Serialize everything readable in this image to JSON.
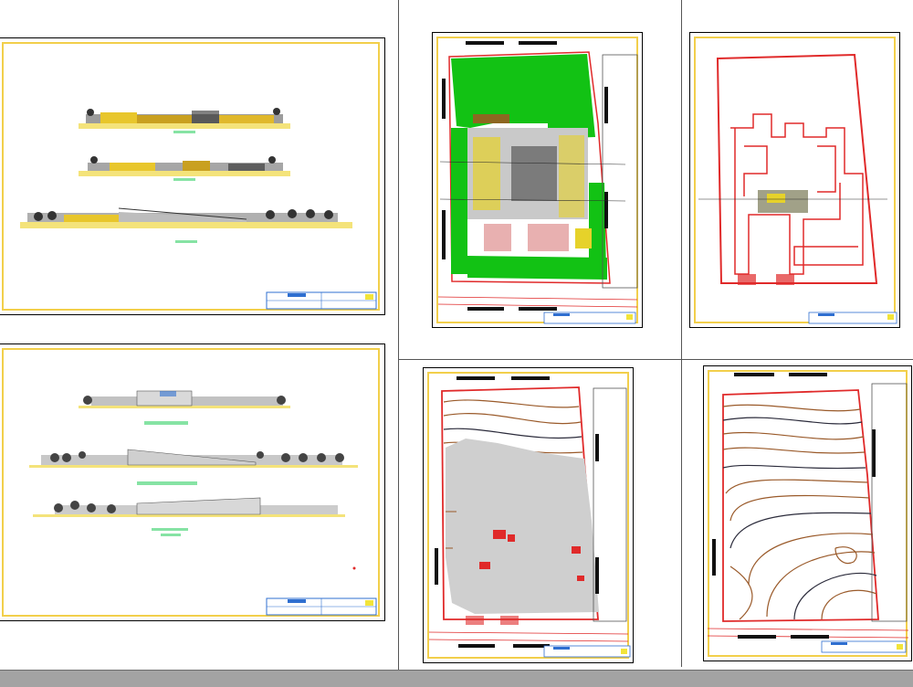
{
  "colors": {
    "sheet_border": "#f2cf4b",
    "vegetation": "#12c214",
    "boundary": "#e02a2a",
    "contour_brown": "#9a5a2a",
    "contour_dark": "#2b2b3b",
    "label_green": "#86e3a4",
    "title_block_blue": "#2f6fd0",
    "background_bar": "#a3a3a3"
  },
  "sheets": [
    {
      "id": "elevations-1",
      "content": "site-elevations"
    },
    {
      "id": "elevations-2",
      "content": "site-elevations"
    },
    {
      "id": "site-plan",
      "content": "site-plan"
    },
    {
      "id": "boundary-plan",
      "content": "boundary-plan"
    },
    {
      "id": "topography-overlay",
      "content": "topography"
    },
    {
      "id": "topography",
      "content": "topography"
    }
  ]
}
